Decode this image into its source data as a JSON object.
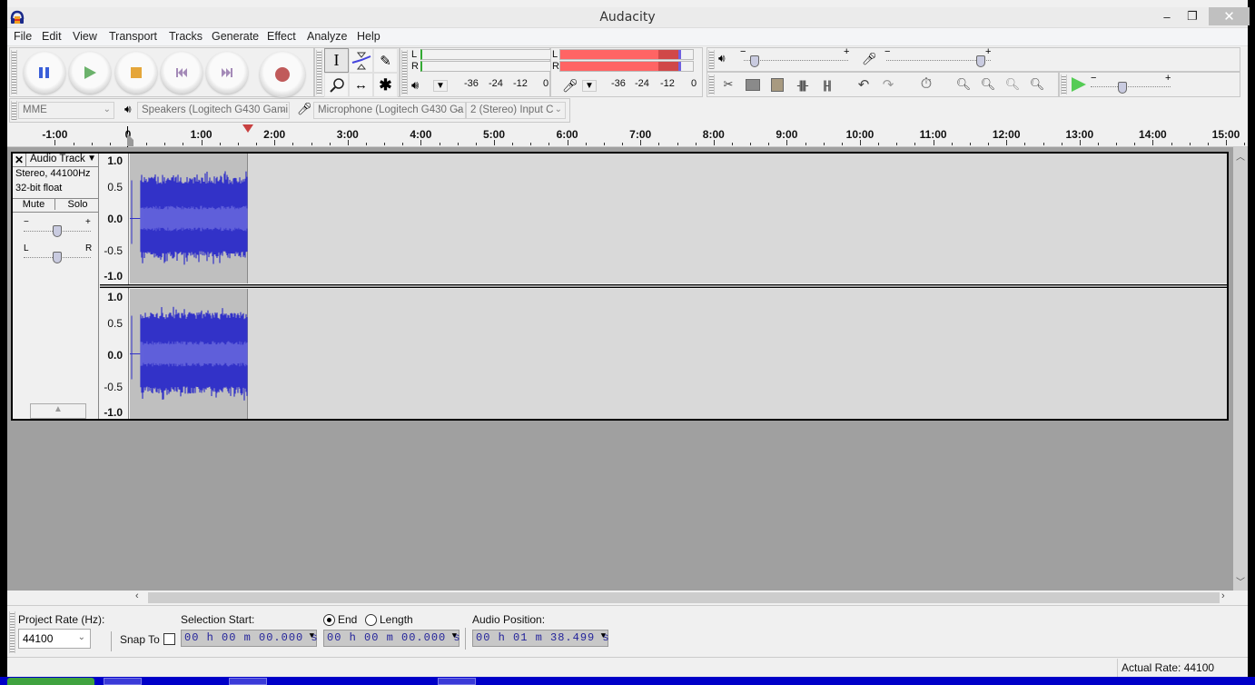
{
  "window": {
    "title": "Audacity",
    "controls": {
      "minimize": "–",
      "maximize": "❐",
      "close": "✕"
    }
  },
  "menu": [
    "File",
    "Edit",
    "View",
    "Transport",
    "Tracks",
    "Generate",
    "Effect",
    "Analyze",
    "Help"
  ],
  "transport": {
    "buttons": [
      {
        "name": "pause",
        "icon": "pause-icon",
        "color": "#3a5fd8"
      },
      {
        "name": "play",
        "icon": "play-icon",
        "color": "#6bb26b"
      },
      {
        "name": "stop",
        "icon": "stop-icon",
        "color": "#e5a63a"
      },
      {
        "name": "skip-to-start",
        "icon": "skip-start-icon",
        "color": "#a48ab8"
      },
      {
        "name": "skip-to-end",
        "icon": "skip-end-icon",
        "color": "#a48ab8"
      },
      {
        "name": "record",
        "icon": "record-icon",
        "color": "#c05a5a"
      }
    ]
  },
  "tools": [
    {
      "name": "selection-tool",
      "glyph": "I"
    },
    {
      "name": "envelope-tool",
      "glyph": "≍"
    },
    {
      "name": "draw-tool",
      "glyph": "✎"
    },
    {
      "name": "zoom-tool",
      "glyph": "⚲"
    },
    {
      "name": "time-shift-tool",
      "glyph": "↔"
    },
    {
      "name": "multi-tool",
      "glyph": "✱"
    }
  ],
  "meters": {
    "playback": {
      "left": "L",
      "right": "R",
      "scale": [
        "-36",
        "-24",
        "-12",
        "0"
      ]
    },
    "record": {
      "left": "L",
      "right": "R",
      "scale": [
        "-36",
        "-24",
        "-12",
        "0"
      ],
      "level_fraction": 0.95,
      "peak_color": "#ff6464",
      "hold_color": "#d04848"
    }
  },
  "mixer": {
    "minus": "−",
    "plus": "+",
    "playback_volume": 0.1,
    "record_volume": 0.9
  },
  "edit_toolbar": [
    "cut-icon",
    "copy-icon",
    "paste-icon",
    "trim-icon",
    "silence-icon",
    "undo-icon",
    "redo-icon",
    "sync-lock-icon",
    "zoom-in-icon",
    "zoom-out-icon",
    "fit-selection-icon",
    "fit-project-icon"
  ],
  "play_at_speed": {
    "minus": "−",
    "plus": "+",
    "speed": 0.4
  },
  "device": {
    "host": "MME",
    "output": "Speakers (Logitech G430 Gami",
    "input": "Microphone (Logitech G430 Ga",
    "channels": "2 (Stereo) Input C"
  },
  "ruler": {
    "ticks": [
      "-1:00",
      "0",
      "1:00",
      "2:00",
      "3:00",
      "4:00",
      "5:00",
      "6:00",
      "7:00",
      "8:00",
      "9:00",
      "10:00",
      "11:00",
      "12:00",
      "13:00",
      "14:00",
      "15:00"
    ],
    "playhead_time_seconds": 98.5
  },
  "track": {
    "name": "Audio Track",
    "info1": "Stereo, 44100Hz",
    "info2": "32-bit float",
    "mute": "Mute",
    "solo": "Solo",
    "gain_minus": "−",
    "gain_plus": "+",
    "pan_left": "L",
    "pan_right": "R",
    "collapse": "▲",
    "vruler": [
      "1.0",
      "0.5",
      "0.0",
      "-0.5",
      "-1.0"
    ],
    "clip_duration_seconds": 98.5,
    "wave_color": "#3232c8",
    "rms_color": "#6464dc"
  },
  "selection": {
    "project_rate_label": "Project Rate (Hz):",
    "project_rate": "44100",
    "snap_to": "Snap To",
    "selection_start_label": "Selection Start:",
    "end_label": "End",
    "length_label": "Length",
    "selection_start": "00 h 00 m 00.000 s",
    "selection_end": "00 h 00 m 00.000 s",
    "audio_position_label": "Audio Position:",
    "audio_position": "00 h 01 m 38.499 s"
  },
  "status": {
    "actual_rate": "Actual Rate: 44100"
  }
}
